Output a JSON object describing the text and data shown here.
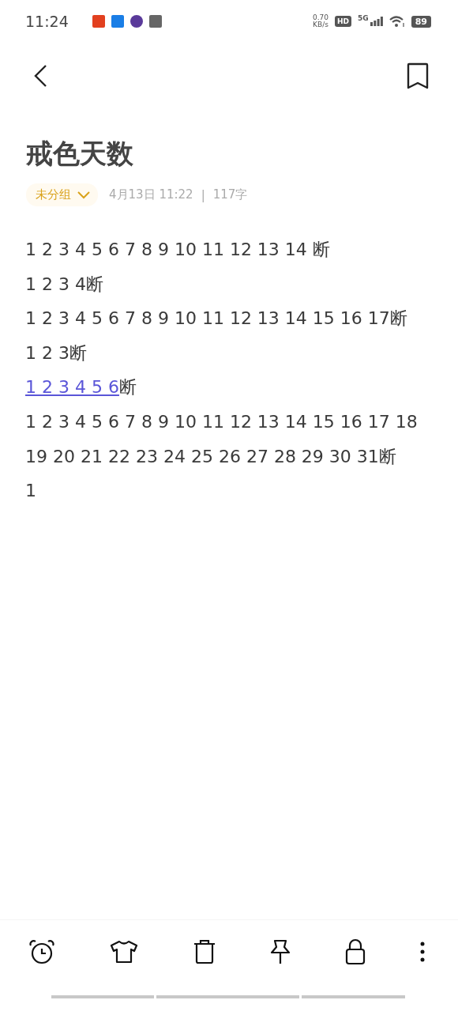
{
  "status_bar": {
    "time": "11:24",
    "net_speed": "0.70",
    "net_unit": "KB/s",
    "hd": "HD",
    "network": "5G",
    "battery": "89"
  },
  "note": {
    "title": "戒色天数",
    "group": "未分组",
    "date": "4月13日 11:22",
    "separator": "|",
    "count": "117字",
    "lines": [
      {
        "text": "1 2 3 4 5 6 7 8 9 10 11 12 13 14 断"
      },
      {
        "text": "1 2 3 4断"
      },
      {
        "text": "1 2 3 4 5 6 7 8 9 10 11 12 13 14 15 16 17断"
      },
      {
        "text": "1 2 3断"
      },
      {
        "link": "1 2 3 4 5 6",
        "text": "断"
      },
      {
        "text": "1 2 3 4 5 6 7 8 9 10 11 12 13 14 15 16 17 18"
      },
      {
        "text": "19 20 21 22 23 24 25 26 27 28 29 30 31断"
      },
      {
        "text": "1"
      }
    ]
  }
}
